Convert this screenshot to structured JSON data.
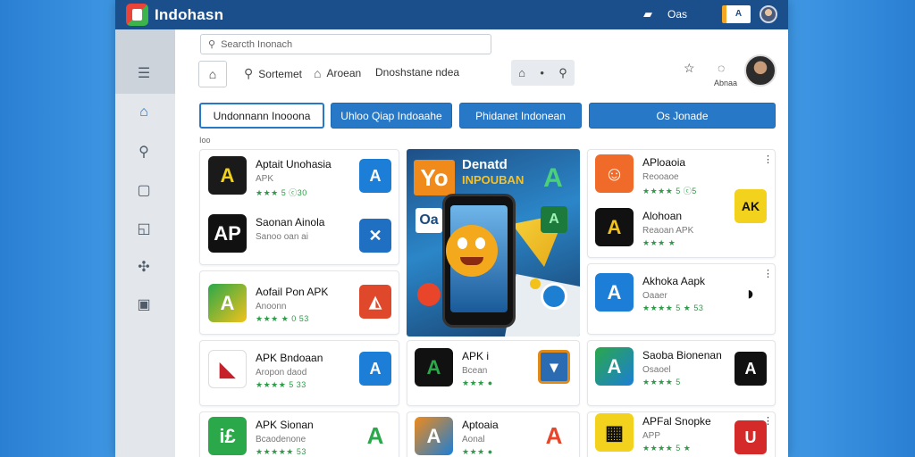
{
  "app": {
    "title": "Indohasn",
    "status_text": "Oas",
    "badge": "A"
  },
  "search": {
    "placeholder": "Searcth Inonach"
  },
  "nav": {
    "links": [
      "Sortemet",
      "Aroean",
      "Dnoshstane ndea"
    ],
    "labels": {
      "notify": "Abnaa"
    }
  },
  "sidebar": {
    "items": [
      "menu-icon",
      "home-icon",
      "user-icon",
      "folder-icon",
      "document-icon",
      "puzzle-icon",
      "page-icon"
    ]
  },
  "tabs": [
    "Undonnann Inooona",
    "Uhloo Qiap Indoaahe",
    "Phidanet Indonean",
    "Os Jonade"
  ],
  "section_label": "Ioo",
  "apps": [
    {
      "name": "Aptait Unohasia",
      "sub": "APK",
      "rating": "★★★ 5 ⓒ30"
    },
    {
      "name": "Saonan Ainola",
      "sub": "Sanoo oan ai",
      "rating": ""
    },
    {
      "name": "Aofail Pon APK",
      "sub": "Anoonn",
      "rating": "★★★ ★ 0 53"
    },
    {
      "name": "APK Bndoaan",
      "sub": "Aropon daod",
      "rating": "★★★★ 5 33"
    },
    {
      "name": "APK Sionan",
      "sub": "Bcaodenone",
      "rating": "★★★★★ 53"
    },
    {
      "name": "APK i",
      "sub": "Bcean",
      "rating": "★★★ ●"
    },
    {
      "name": "Aptoaia",
      "sub": "Aonal",
      "rating": "★★★ ●"
    },
    {
      "name": "APloaoia",
      "sub": "Reooaoe",
      "rating": "★★★★ 5 ⓒ5"
    },
    {
      "name": "Alohoan",
      "sub": "Reaoan APK",
      "rating": "★★★ ★"
    },
    {
      "name": "Akhoka Aapk",
      "sub": "Oaaer",
      "rating": "★★★★ 5 ★ 53"
    },
    {
      "name": "Saoba Bionenan",
      "sub": "Osaoel",
      "rating": "★★★★ 5"
    },
    {
      "name": "APFal Snopke",
      "sub": "APP",
      "rating": "★★★★ 5 ★"
    }
  ],
  "banner": {
    "badge": "Yo",
    "title": "Denatd",
    "subtitle": "INPOUBAN",
    "tag": "Oa"
  }
}
